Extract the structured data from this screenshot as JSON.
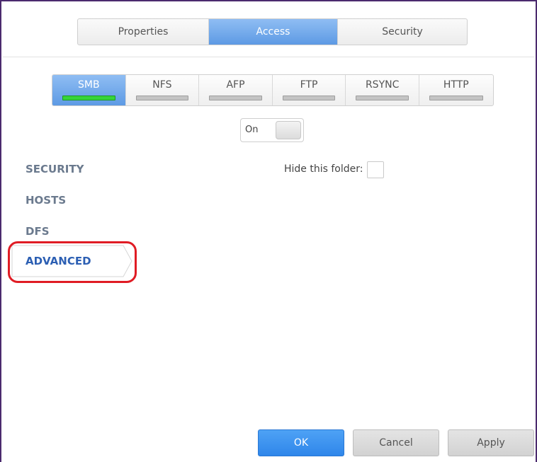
{
  "main_tabs": [
    {
      "label": "Properties"
    },
    {
      "label": "Access"
    },
    {
      "label": "Security"
    }
  ],
  "main_tabs_active": "Access",
  "protocol_tabs": [
    {
      "label": "SMB",
      "enabled": true
    },
    {
      "label": "NFS",
      "enabled": false
    },
    {
      "label": "AFP",
      "enabled": false
    },
    {
      "label": "FTP",
      "enabled": false
    },
    {
      "label": "RSYNC",
      "enabled": false
    },
    {
      "label": "HTTP",
      "enabled": false
    }
  ],
  "protocol_tabs_active": "SMB",
  "toggle": {
    "label": "On"
  },
  "nav": {
    "items": [
      {
        "label": "SECURITY"
      },
      {
        "label": "HOSTS"
      },
      {
        "label": "DFS"
      },
      {
        "label": "ADVANCED"
      }
    ],
    "active": "ADVANCED"
  },
  "hide_folder": {
    "label": "Hide this folder:",
    "checked": false
  },
  "buttons": {
    "ok": "OK",
    "cancel": "Cancel",
    "apply": "Apply"
  },
  "colors": {
    "accent_blue": "#5d9ae4",
    "ok_blue": "#2f86ea",
    "enabled_green": "#35d43a",
    "highlight_red": "#e01c24",
    "nav_active": "#2c5fb3",
    "nav_inactive": "#6b7a8e"
  }
}
